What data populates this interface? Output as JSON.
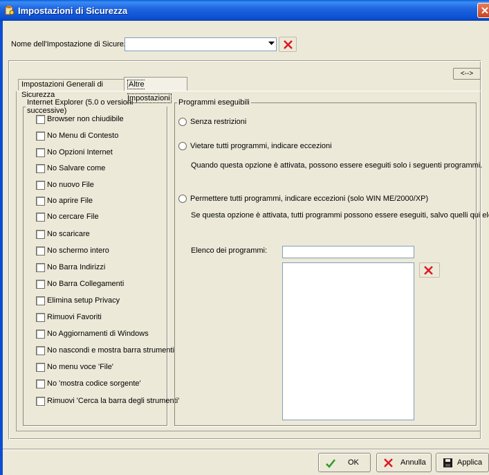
{
  "window": {
    "title": "Impostazioni di Sicurezza"
  },
  "header": {
    "name_label": "Nome dell'Impostazione di Sicurezza:",
    "name_value": ""
  },
  "swap_button": "<-->",
  "tabs": [
    {
      "label": "Impostazioni Generali di Sicurezza",
      "active": false
    },
    {
      "label": "Altre Impostazioni",
      "active": true
    }
  ],
  "ie_group": {
    "legend": "Internet Explorer (5.0 o versioni successive)",
    "items": [
      {
        "label": "Browser non chiudibile",
        "checked": false
      },
      {
        "label": "No Menu di Contesto",
        "checked": false
      },
      {
        "label": "No Opzioni  Internet",
        "checked": false
      },
      {
        "label": "No Salvare come",
        "checked": false
      },
      {
        "label": "No nuovo File",
        "checked": false
      },
      {
        "label": "No aprire File",
        "checked": false
      },
      {
        "label": "No cercare File",
        "checked": false
      },
      {
        "label": "No scaricare",
        "checked": false
      },
      {
        "label": "No schermo intero",
        "checked": false
      },
      {
        "label": "No Barra Indirizzi",
        "checked": false
      },
      {
        "label": "No Barra Collegamenti",
        "checked": false
      },
      {
        "label": "Elimina setup Privacy",
        "checked": false
      },
      {
        "label": "Rimuovi Favoriti",
        "checked": false
      },
      {
        "label": "No Aggiornamenti di Windows",
        "checked": false
      },
      {
        "label": "No nascondi e mostra barra strumenti",
        "checked": false
      },
      {
        "label": "No menu voce 'File'",
        "checked": false
      },
      {
        "label": "No 'mostra codice sorgente'",
        "checked": false
      },
      {
        "label": "Rimuovi 'Cerca la barra degli strumenti'",
        "checked": false
      }
    ]
  },
  "programs_group": {
    "legend": "Programmi eseguibili",
    "options": [
      {
        "label": "Senza restrizioni",
        "description": "",
        "selected": false
      },
      {
        "label": "Vietare tutti programmi, indicare eccezioni",
        "description": "Quando questa opzione è attivata, possono essere eseguiti solo i seguenti programmi.",
        "selected": false
      },
      {
        "label": "Permettere tutti programmi, indicare eccezioni (solo WIN ME/2000/XP)",
        "description": "Se questa opzione è attivata, tutti programmi possono essere eseguiti, salvo quelli qui elencati.",
        "selected": false
      }
    ],
    "list_label": "Elenco dei programmi:",
    "list_input_value": ""
  },
  "footer": {
    "ok": "OK",
    "cancel": "Annulla",
    "apply": "Applica"
  },
  "colors": {
    "titlebar": "#0b4fd0",
    "delete_x": "#e0141e",
    "ok_check": "#2a9a2a"
  }
}
